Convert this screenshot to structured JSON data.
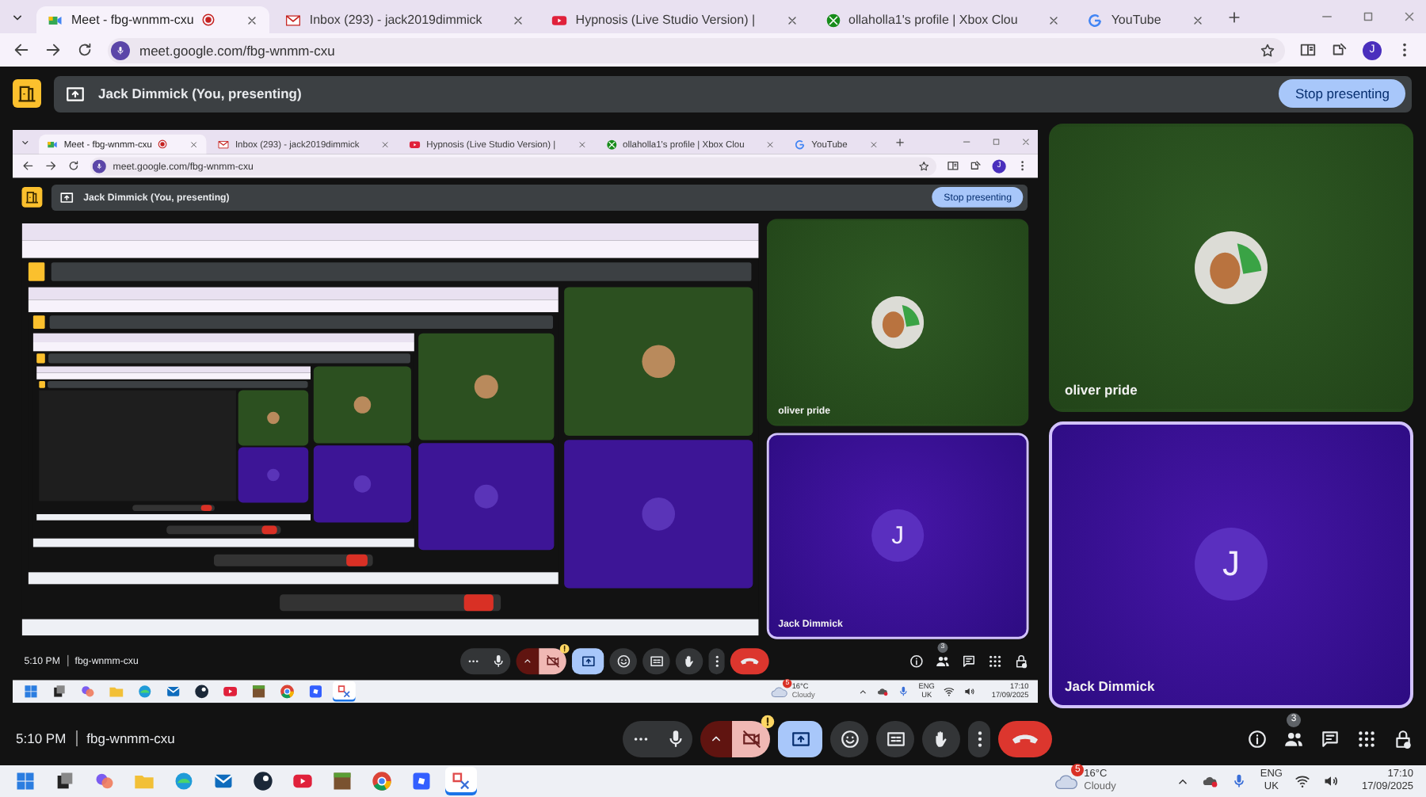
{
  "screen": {
    "browser": {
      "tabs": [
        {
          "title": "Meet - fbg-wnmm-cxu",
          "kind": "meet",
          "recording": true,
          "selected": true
        },
        {
          "title": "Inbox (293) - jack2019dimmick",
          "kind": "mail",
          "recording": false,
          "selected": false
        },
        {
          "title": "Hypnosis (Live Studio Version) |",
          "kind": "video",
          "recording": false,
          "selected": false
        },
        {
          "title": "ollaholla1's profile | Xbox Clou",
          "kind": "game",
          "recording": false,
          "selected": false
        },
        {
          "title": "YouTube",
          "kind": "search",
          "recording": false,
          "selected": false
        }
      ],
      "url": "meet.google.com/fbg-wnmm-cxu",
      "profile_initial": "J"
    },
    "meet": {
      "banner": "Jack Dimmick (You, presenting)",
      "stop_button": "Stop presenting",
      "presentation": {
        "kind": "screen",
        "browser": {
          "tabs": [
            {
              "title": "Meet - fbg-wnmm-cxu",
              "kind": "meet",
              "recording": true,
              "selected": true
            },
            {
              "title": "Inbox (293) - jack2019dimmick",
              "kind": "mail",
              "recording": false,
              "selected": false
            },
            {
              "title": "Hypnosis (Live Studio Version) |",
              "kind": "video",
              "recording": false,
              "selected": false
            },
            {
              "title": "ollaholla1's profile | Xbox Clou",
              "kind": "game",
              "recording": false,
              "selected": false
            },
            {
              "title": "YouTube",
              "kind": "search",
              "recording": false,
              "selected": false
            }
          ],
          "url": "meet.google.com/fbg-wnmm-cxu",
          "profile_initial": "J"
        },
        "meet": {
          "banner": "Jack Dimmick (You, presenting)",
          "stop_button": "Stop presenting",
          "presentation": {
            "kind": "mirror"
          },
          "tiles": [
            {
              "name": "oliver pride",
              "kind": "photo",
              "highlighted": false
            },
            {
              "name": "Jack Dimmick",
              "kind": "initial",
              "initial": "J",
              "highlighted": true
            }
          ],
          "time": "5:10 PM",
          "meeting_code": "fbg-wnmm-cxu",
          "controls": [
            {
              "kind": "mic",
              "on": true
            },
            {
              "kind": "camera",
              "on": false,
              "warning": true
            },
            {
              "kind": "present",
              "on": true
            },
            {
              "kind": "reactions"
            },
            {
              "kind": "captions"
            },
            {
              "kind": "raise-hand"
            },
            {
              "kind": "more"
            },
            {
              "kind": "end-call"
            }
          ],
          "side_buttons": [
            {
              "kind": "info"
            },
            {
              "kind": "people",
              "badge": "3"
            },
            {
              "kind": "chat"
            },
            {
              "kind": "activities"
            },
            {
              "kind": "host-controls"
            }
          ]
        },
        "taskbar": {
          "apps": [
            {
              "kind": "start",
              "selected": false
            },
            {
              "kind": "task-view",
              "selected": false
            },
            {
              "kind": "assistant",
              "selected": false
            },
            {
              "kind": "files",
              "selected": false
            },
            {
              "kind": "browser",
              "selected": false
            },
            {
              "kind": "mail",
              "selected": false
            },
            {
              "kind": "game-store",
              "selected": false
            },
            {
              "kind": "video",
              "selected": false
            },
            {
              "kind": "block-game",
              "selected": false
            },
            {
              "kind": "web",
              "selected": false
            },
            {
              "kind": "square-game",
              "selected": false
            },
            {
              "kind": "snip",
              "selected": true
            }
          ],
          "weather": {
            "badge": "5",
            "temperature": "16°C",
            "condition": "Cloudy"
          },
          "language": "ENG",
          "region": "UK",
          "time": "17:10",
          "date": "17/09/2025"
        }
      },
      "tiles": [
        {
          "name": "oliver pride",
          "kind": "photo",
          "highlighted": false
        },
        {
          "name": "Jack Dimmick",
          "kind": "initial",
          "initial": "J",
          "highlighted": true
        }
      ],
      "time": "5:10 PM",
      "meeting_code": "fbg-wnmm-cxu",
      "controls": [
        {
          "kind": "mic",
          "on": true
        },
        {
          "kind": "camera",
          "on": false,
          "warning": true
        },
        {
          "kind": "present",
          "on": true
        },
        {
          "kind": "reactions"
        },
        {
          "kind": "captions"
        },
        {
          "kind": "raise-hand"
        },
        {
          "kind": "more"
        },
        {
          "kind": "end-call"
        }
      ],
      "side_buttons": [
        {
          "kind": "info"
        },
        {
          "kind": "people",
          "badge": "3"
        },
        {
          "kind": "chat"
        },
        {
          "kind": "activities"
        },
        {
          "kind": "host-controls"
        }
      ]
    },
    "taskbar": {
      "apps": [
        {
          "kind": "start",
          "selected": false
        },
        {
          "kind": "task-view",
          "selected": false
        },
        {
          "kind": "assistant",
          "selected": false
        },
        {
          "kind": "files",
          "selected": false
        },
        {
          "kind": "browser",
          "selected": false
        },
        {
          "kind": "mail",
          "selected": false
        },
        {
          "kind": "game-store",
          "selected": false
        },
        {
          "kind": "video",
          "selected": false
        },
        {
          "kind": "block-game",
          "selected": false
        },
        {
          "kind": "web",
          "selected": false
        },
        {
          "kind": "square-game",
          "selected": false
        },
        {
          "kind": "snip",
          "selected": true
        }
      ],
      "weather": {
        "badge": "5",
        "temperature": "16°C",
        "condition": "Cloudy"
      },
      "language": "ENG",
      "region": "UK",
      "time": "17:10",
      "date": "17/09/2025"
    }
  }
}
